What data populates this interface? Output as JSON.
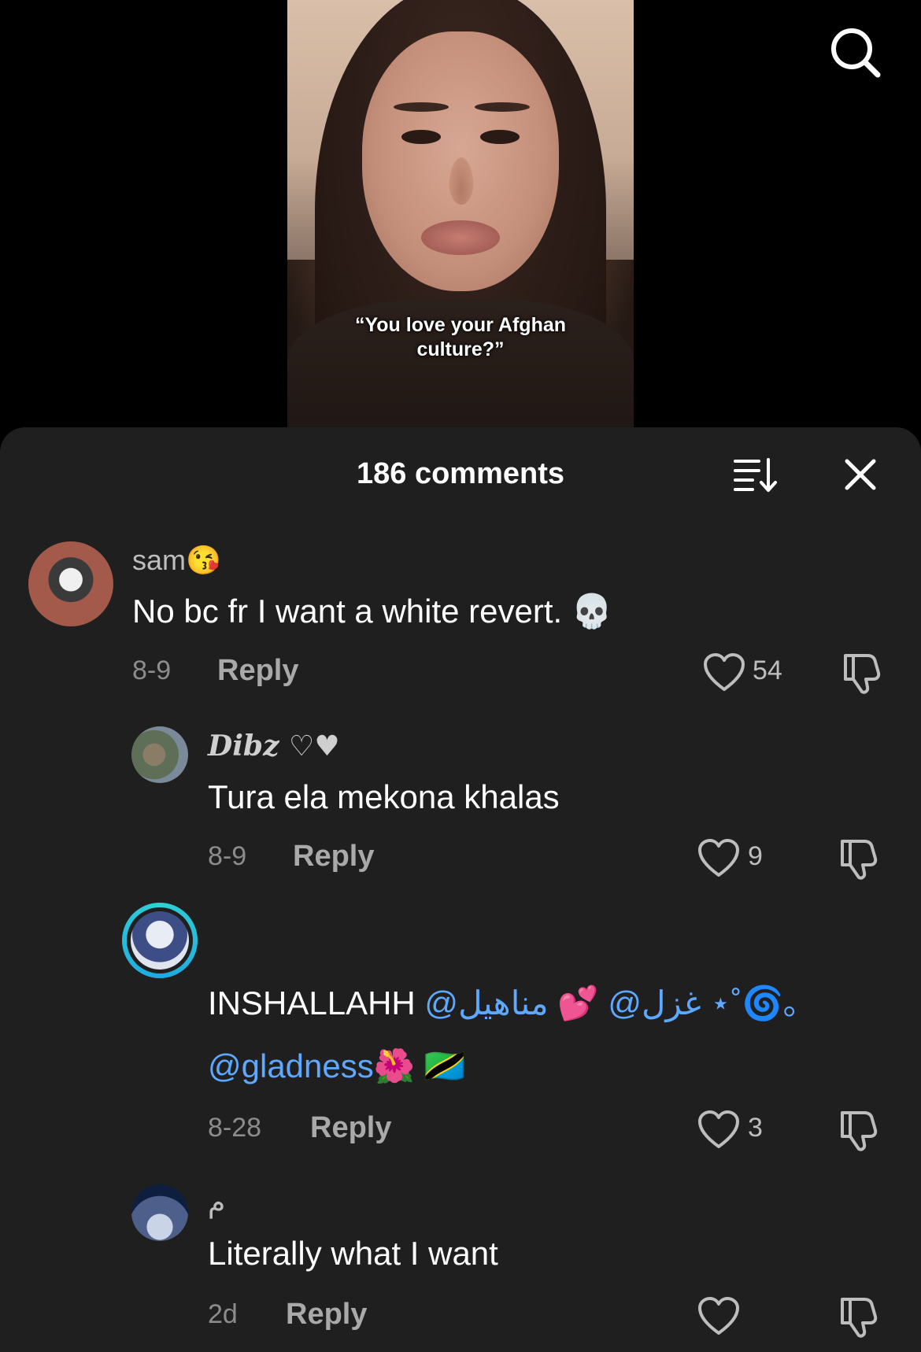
{
  "video": {
    "caption_line1": "“You love your Afghan",
    "caption_line2": "culture?”"
  },
  "header": {
    "comments_count": "186 comments"
  },
  "icons": {
    "search": "search-icon",
    "sort": "sort-icon",
    "close": "close-icon",
    "like": "heart-icon",
    "dislike": "thumbs-down-icon"
  },
  "comments": [
    {
      "username": "sam😘",
      "text": "No bc fr I want a white revert. 💀",
      "date": "8-9",
      "reply": "Reply",
      "likes": "54"
    },
    {
      "username": "Dibz ♡♥",
      "text": "Tura ela mekona khalas",
      "date": "8-9",
      "reply": "Reply",
      "likes": "9"
    },
    {
      "username": "",
      "text_plain": "INSHALLAHH ",
      "mention1": "@غزل@",
      "text_mid": " 💕 ",
      "mention2": "مناهيل ⋆˚🌀｡",
      "mention3": "@gladness",
      "text_end": "🌺 🇹🇿",
      "date": "8-28",
      "reply": "Reply",
      "likes": "3"
    },
    {
      "username": "م",
      "text": "Literally what I want",
      "date": "2d",
      "reply": "Reply",
      "likes": ""
    }
  ],
  "colors": {
    "sheet_bg": "#1f1f1f",
    "mention": "#5fa8ff",
    "avatar_ring": "#2fd0d4"
  }
}
